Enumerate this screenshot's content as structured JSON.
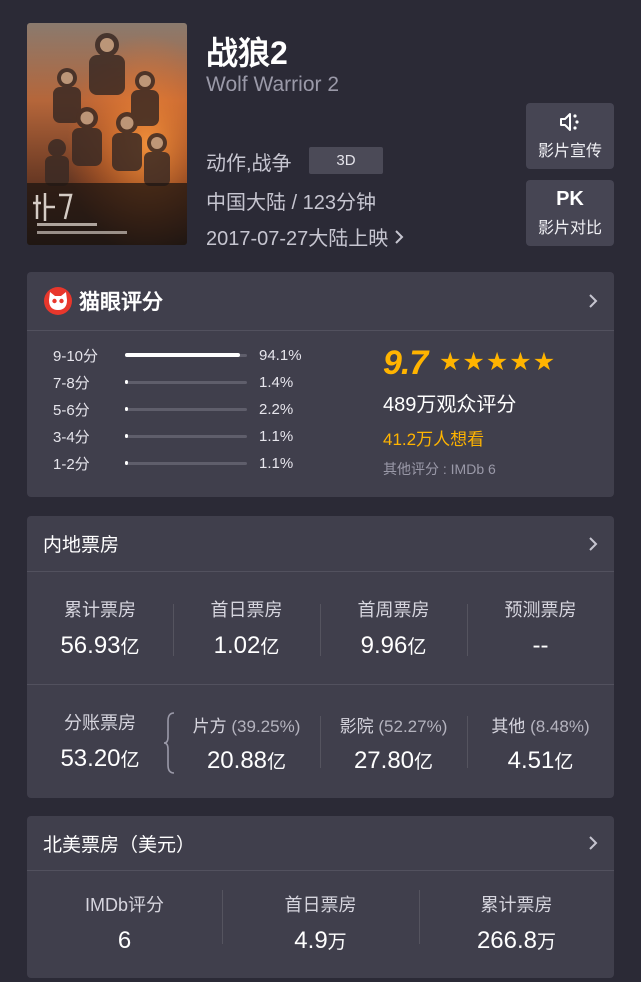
{
  "movie": {
    "title": "战狼2",
    "english_title": "Wolf Warrior 2",
    "genre": "动作,战争",
    "format_badge": "3D",
    "region_duration": "中国大陆 / 123分钟",
    "release": "2017-07-27大陆上映"
  },
  "actions": {
    "promo_label": "影片宣传",
    "pk_icon_text": "PK",
    "compare_label": "影片对比"
  },
  "rating": {
    "title": "猫眼评分",
    "score": "9.7",
    "stars": 5,
    "distribution": [
      {
        "label": "9-10分",
        "pct": "94.1%",
        "fraction": 0.941
      },
      {
        "label": "7-8分",
        "pct": "1.4%",
        "fraction": 0.014
      },
      {
        "label": "5-6分",
        "pct": "2.2%",
        "fraction": 0.022
      },
      {
        "label": "3-4分",
        "pct": "1.1%",
        "fraction": 0.011
      },
      {
        "label": "1-2分",
        "pct": "1.1%",
        "fraction": 0.011
      }
    ],
    "viewers": "489万观众评分",
    "want_to_see": "41.2万人想看",
    "other_ratings": "其他评分 : IMDb 6"
  },
  "mainland": {
    "title": "内地票房",
    "stats": [
      {
        "label": "累计票房",
        "value": "56.93",
        "unit": "亿"
      },
      {
        "label": "首日票房",
        "value": "1.02",
        "unit": "亿"
      },
      {
        "label": "首周票房",
        "value": "9.96",
        "unit": "亿"
      },
      {
        "label": "预测票房",
        "value": "--",
        "unit": ""
      }
    ],
    "split_label": "分账票房",
    "split_value": "53.20",
    "split_unit": "亿",
    "splits": [
      {
        "label": "片方",
        "pct": "(39.25%)",
        "value": "20.88",
        "unit": "亿"
      },
      {
        "label": "影院",
        "pct": "(52.27%)",
        "value": "27.80",
        "unit": "亿"
      },
      {
        "label": "其他",
        "pct": "(8.48%)",
        "value": "4.51",
        "unit": "亿"
      }
    ]
  },
  "north_america": {
    "title": "北美票房（美元）",
    "stats": [
      {
        "label": "IMDb评分",
        "value": "6",
        "unit": ""
      },
      {
        "label": "首日票房",
        "value": "4.9",
        "unit": "万"
      },
      {
        "label": "累计票房",
        "value": "266.8",
        "unit": "万"
      }
    ]
  },
  "colors": {
    "background": "#2b2a36",
    "card": "#403f4c",
    "accent": "#ffb400",
    "maoyan_red": "#e8372c"
  }
}
